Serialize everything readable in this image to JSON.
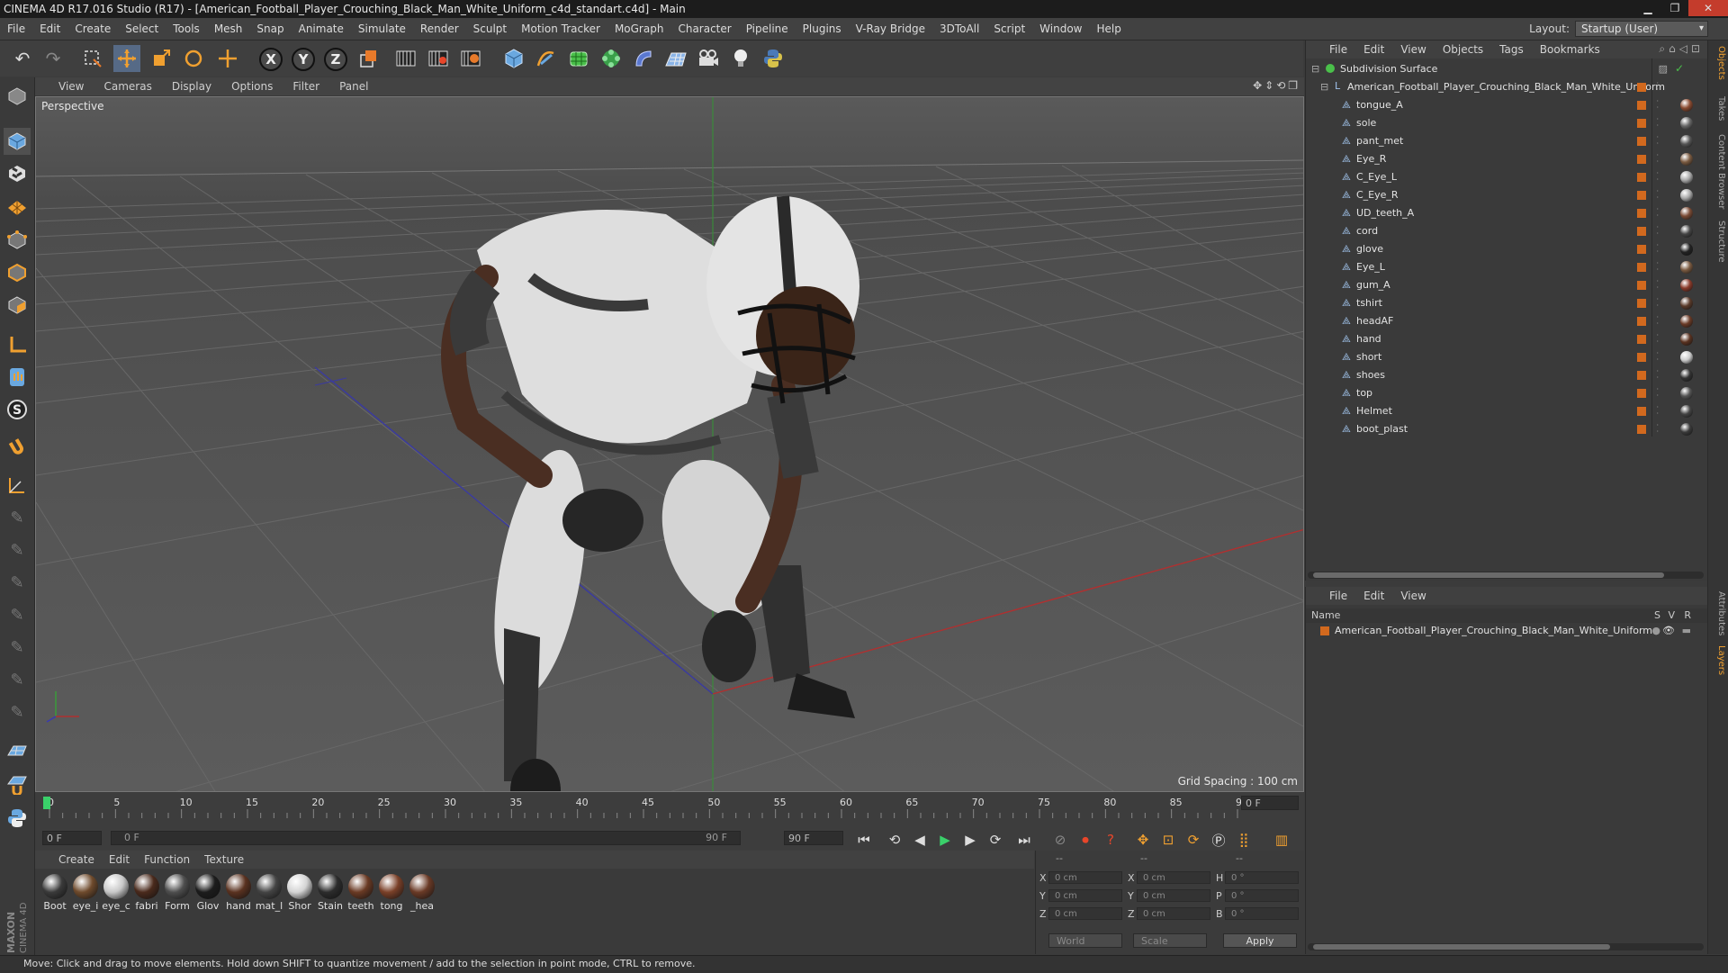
{
  "title": "CINEMA 4D R17.016 Studio (R17) - [American_Football_Player_Crouching_Black_Man_White_Uniform_c4d_standart.c4d] - Main",
  "menu": [
    "File",
    "Edit",
    "Create",
    "Select",
    "Tools",
    "Mesh",
    "Snap",
    "Animate",
    "Simulate",
    "Render",
    "Sculpt",
    "Motion Tracker",
    "MoGraph",
    "Character",
    "Pipeline",
    "Plugins",
    "V-Ray Bridge",
    "3DToAll",
    "Script",
    "Window",
    "Help"
  ],
  "layout": {
    "label": "Layout:",
    "value": "Startup (User)"
  },
  "viewport": {
    "menu": [
      "View",
      "Cameras",
      "Display",
      "Options",
      "Filter",
      "Panel"
    ],
    "label": "Perspective",
    "grid_spacing": "Grid Spacing : 100 cm"
  },
  "timeline": {
    "ticks": [
      "0",
      "5",
      "10",
      "15",
      "20",
      "25",
      "30",
      "35",
      "40",
      "45",
      "50",
      "55",
      "60",
      "65",
      "70",
      "75",
      "80",
      "85",
      "90"
    ],
    "current_frame": "0 F",
    "start_field": "0 F",
    "range_start": "0 F",
    "range_end": "90 F",
    "end_field": "90 F"
  },
  "materials": {
    "menu": [
      "Create",
      "Edit",
      "Function",
      "Texture"
    ],
    "items": [
      {
        "name": "Boot",
        "color": "#3a3a3a"
      },
      {
        "name": "eye_i",
        "color": "#6e4a2c"
      },
      {
        "name": "eye_c",
        "color": "#c8c8c8"
      },
      {
        "name": "fabri",
        "color": "#4a2a1c"
      },
      {
        "name": "Form",
        "color": "#4e4e4e"
      },
      {
        "name": "Glov",
        "color": "#1c1c1c"
      },
      {
        "name": "hand",
        "color": "#5a3220"
      },
      {
        "name": "mat_l",
        "color": "#444444"
      },
      {
        "name": "Shor",
        "color": "#d4d4d4"
      },
      {
        "name": "Stain",
        "color": "#2c2c2c"
      },
      {
        "name": "teeth",
        "color": "#6a3a24"
      },
      {
        "name": "tong",
        "color": "#7a4028"
      },
      {
        "name": "_hea",
        "color": "#6a3a26"
      }
    ]
  },
  "coords": {
    "header": [
      "--",
      "--",
      "--"
    ],
    "rows": [
      {
        "a": "X",
        "av": "0 cm",
        "b": "X",
        "bv": "0 cm",
        "c": "H",
        "cv": "0 °"
      },
      {
        "a": "Y",
        "av": "0 cm",
        "b": "Y",
        "bv": "0 cm",
        "c": "P",
        "cv": "0 °"
      },
      {
        "a": "Z",
        "av": "0 cm",
        "b": "Z",
        "bv": "0 cm",
        "c": "B",
        "cv": "0 °"
      }
    ],
    "world": "World",
    "scale": "Scale",
    "apply": "Apply"
  },
  "status": "Move: Click and drag to move elements. Hold down SHIFT to quantize movement / add to the selection in point mode, CTRL to remove.",
  "objects": {
    "menu": [
      "File",
      "Edit",
      "View",
      "Objects",
      "Tags",
      "Bookmarks"
    ],
    "root": "Subdivision Surface",
    "group": "American_Football_Player_Crouching_Black_Man_White_Uniform",
    "children": [
      {
        "name": "tongue_A",
        "tag": "#8a4a30"
      },
      {
        "name": "sole",
        "tag": "#666666"
      },
      {
        "name": "pant_met",
        "tag": "#555555"
      },
      {
        "name": "Eye_R",
        "tag": "#7a5a40"
      },
      {
        "name": "C_Eye_L",
        "tag": "#aaaaaa"
      },
      {
        "name": "C_Eye_R",
        "tag": "#aaaaaa"
      },
      {
        "name": "UD_teeth_A",
        "tag": "#7a4a34"
      },
      {
        "name": "cord",
        "tag": "#444444"
      },
      {
        "name": "glove",
        "tag": "#222222"
      },
      {
        "name": "Eye_L",
        "tag": "#7a5a40"
      },
      {
        "name": "gum_A",
        "tag": "#8a3a2a"
      },
      {
        "name": "tshirt",
        "tag": "#5a3a2a"
      },
      {
        "name": "headAF",
        "tag": "#6a3a26"
      },
      {
        "name": "hand",
        "tag": "#5a3220"
      },
      {
        "name": "short",
        "tag": "#cccccc"
      },
      {
        "name": "shoes",
        "tag": "#333333"
      },
      {
        "name": "top",
        "tag": "#555555"
      },
      {
        "name": "Helmet",
        "tag": "#444444"
      },
      {
        "name": "boot_plast",
        "tag": "#3a3a3a"
      }
    ]
  },
  "layers": {
    "menu": [
      "File",
      "Edit",
      "View"
    ],
    "columns": {
      "name": "Name",
      "s": "S",
      "v": "V",
      "r": "R"
    },
    "items": [
      "American_Football_Player_Crouching_Black_Man_White_Uniform"
    ]
  },
  "side_tabs": [
    "Objects",
    "Takes",
    "Content Browser",
    "Structure",
    "Attributes",
    "Layers"
  ],
  "logo": "MAXON CINEMA 4D"
}
